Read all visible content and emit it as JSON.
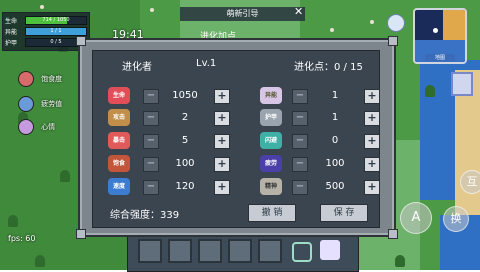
{
  "hud": {
    "stats": [
      {
        "label": "生命",
        "value": "714 / 1050",
        "color": "#4fbf3f",
        "fill": 0.68
      },
      {
        "label": "异能",
        "value": "1 / 1",
        "color": "#3f9fd8",
        "fill": 1.0
      },
      {
        "label": "护甲",
        "value": "0 / 5",
        "color": "#9aa4ae",
        "fill": 0.0
      }
    ],
    "timer": "19:41",
    "guide_title": "萌新引导",
    "guide_sub": "进化加点",
    "fps": "fps: 60",
    "left_labels": [
      "饱食度",
      "疲劳值",
      "心情"
    ],
    "minimap_label": "地图",
    "buttons": {
      "interact": "互",
      "attack": "A",
      "swap": "换"
    }
  },
  "dialog": {
    "evolver_label": "进化者",
    "level": "Lv.1",
    "points_label": "进化点：0 / 15",
    "left_stats": [
      {
        "icon": "生命",
        "icon_color": "#e24e57",
        "value": "1050"
      },
      {
        "icon": "攻击",
        "icon_color": "#c28f4a",
        "value": "2"
      },
      {
        "icon": "暴击",
        "icon_color": "#e05a5a",
        "value": "5"
      },
      {
        "icon": "饱食",
        "icon_color": "#c2553a",
        "value": "100"
      },
      {
        "icon": "速度",
        "icon_color": "#3c7cd1",
        "value": "120"
      }
    ],
    "right_stats": [
      {
        "icon": "异能",
        "icon_color": "#d8c6e6",
        "value": "1"
      },
      {
        "icon": "护甲",
        "icon_color": "#9aa4ae",
        "value": "1"
      },
      {
        "icon": "闪避",
        "icon_color": "#3fb0a6",
        "value": "0"
      },
      {
        "icon": "疲劳",
        "icon_color": "#4b3fa8",
        "value": "100"
      },
      {
        "icon": "精神",
        "icon_color": "#b7b2a8",
        "value": "500"
      }
    ],
    "strength_label": "综合强度：339",
    "undo_label": "撤 销",
    "save_label": "保 存"
  }
}
